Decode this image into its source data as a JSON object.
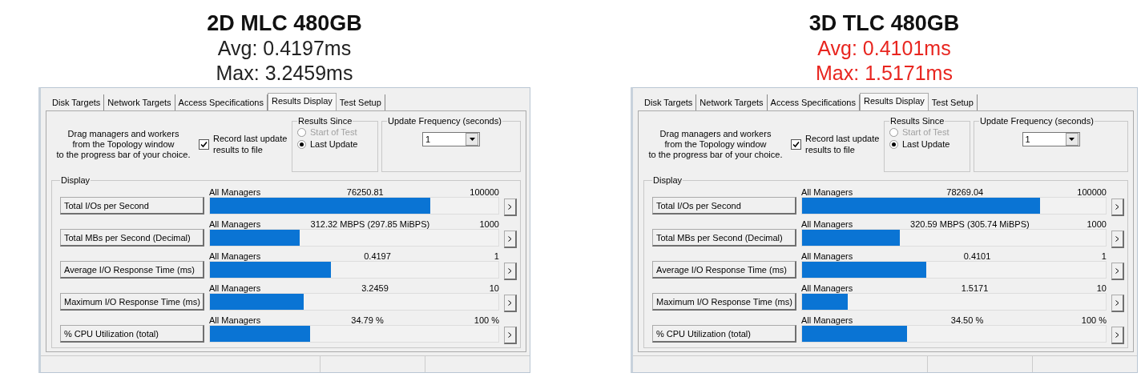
{
  "panels": [
    {
      "title": "2D MLC 480GB",
      "stats": [
        {
          "text": "Avg: 0.4197ms",
          "color": "#222222"
        },
        {
          "text": "Max: 3.2459ms",
          "color": "#222222"
        }
      ],
      "window": {
        "tabs": [
          {
            "label": "Disk Targets",
            "selected": false
          },
          {
            "label": "Network Targets",
            "selected": false
          },
          {
            "label": "Access Specifications",
            "selected": false
          },
          {
            "label": "Results Display",
            "selected": true
          },
          {
            "label": "Test Setup",
            "selected": false
          }
        ],
        "hint_lines": [
          "Drag managers and workers",
          "from the Topology window",
          "to the progress bar of your choice."
        ],
        "record": {
          "label": "Record last update results to file",
          "checked": true
        },
        "results_since": {
          "title": "Results Since",
          "options": [
            {
              "label": "Start of Test",
              "selected": false,
              "disabled": true
            },
            {
              "label": "Last Update",
              "selected": true,
              "disabled": false
            }
          ]
        },
        "update_frequency": {
          "title": "Update Frequency (seconds)",
          "value": "1"
        },
        "display": {
          "title": "Display",
          "rows": [
            {
              "label": "Total I/Os per Second",
              "source": "All Managers",
              "reading": "76250.81",
              "max": "100000",
              "level": 0.7625
            },
            {
              "label": "Total MBs per Second (Decimal)",
              "source": "All Managers",
              "reading": "312.32 MBPS (297.85 MiBPS)",
              "max": "1000",
              "level": 0.3123
            },
            {
              "label": "Average I/O Response Time (ms)",
              "source": "All Managers",
              "reading": "0.4197",
              "max": "1",
              "level": 0.4197
            },
            {
              "label": "Maximum I/O Response Time (ms)",
              "source": "All Managers",
              "reading": "3.2459",
              "max": "10",
              "level": 0.3246
            },
            {
              "label": "% CPU Utilization (total)",
              "source": "All Managers",
              "reading": "34.79 %",
              "max": "100 %",
              "level": 0.3479
            }
          ]
        }
      }
    },
    {
      "title": "3D TLC 480GB",
      "stats": [
        {
          "text": "Avg: 0.4101ms",
          "color": "#e8251f"
        },
        {
          "text": "Max: 1.5171ms",
          "color": "#e8251f"
        }
      ],
      "window": {
        "tabs": [
          {
            "label": "Disk Targets",
            "selected": false
          },
          {
            "label": "Network Targets",
            "selected": false
          },
          {
            "label": "Access Specifications",
            "selected": false
          },
          {
            "label": "Results Display",
            "selected": true
          },
          {
            "label": "Test Setup",
            "selected": false
          }
        ],
        "hint_lines": [
          "Drag managers and workers",
          "from the Topology window",
          "to the progress bar of your choice."
        ],
        "record": {
          "label": "Record last update results to file",
          "checked": true
        },
        "results_since": {
          "title": "Results Since",
          "options": [
            {
              "label": "Start of Test",
              "selected": false,
              "disabled": true
            },
            {
              "label": "Last Update",
              "selected": true,
              "disabled": false
            }
          ]
        },
        "update_frequency": {
          "title": "Update Frequency (seconds)",
          "value": "1"
        },
        "display": {
          "title": "Display",
          "rows": [
            {
              "label": "Total I/Os per Second",
              "source": "All Managers",
              "reading": "78269.04",
              "max": "100000",
              "level": 0.7827
            },
            {
              "label": "Total MBs per Second (Decimal)",
              "source": "All Managers",
              "reading": "320.59 MBPS (305.74 MiBPS)",
              "max": "1000",
              "level": 0.3206
            },
            {
              "label": "Average I/O Response Time (ms)",
              "source": "All Managers",
              "reading": "0.4101",
              "max": "1",
              "level": 0.4101
            },
            {
              "label": "Maximum I/O Response Time (ms)",
              "source": "All Managers",
              "reading": "1.5171",
              "max": "10",
              "level": 0.1517
            },
            {
              "label": "% CPU Utilization (total)",
              "source": "All Managers",
              "reading": "34.50 %",
              "max": "100 %",
              "level": 0.345
            }
          ]
        }
      }
    }
  ]
}
